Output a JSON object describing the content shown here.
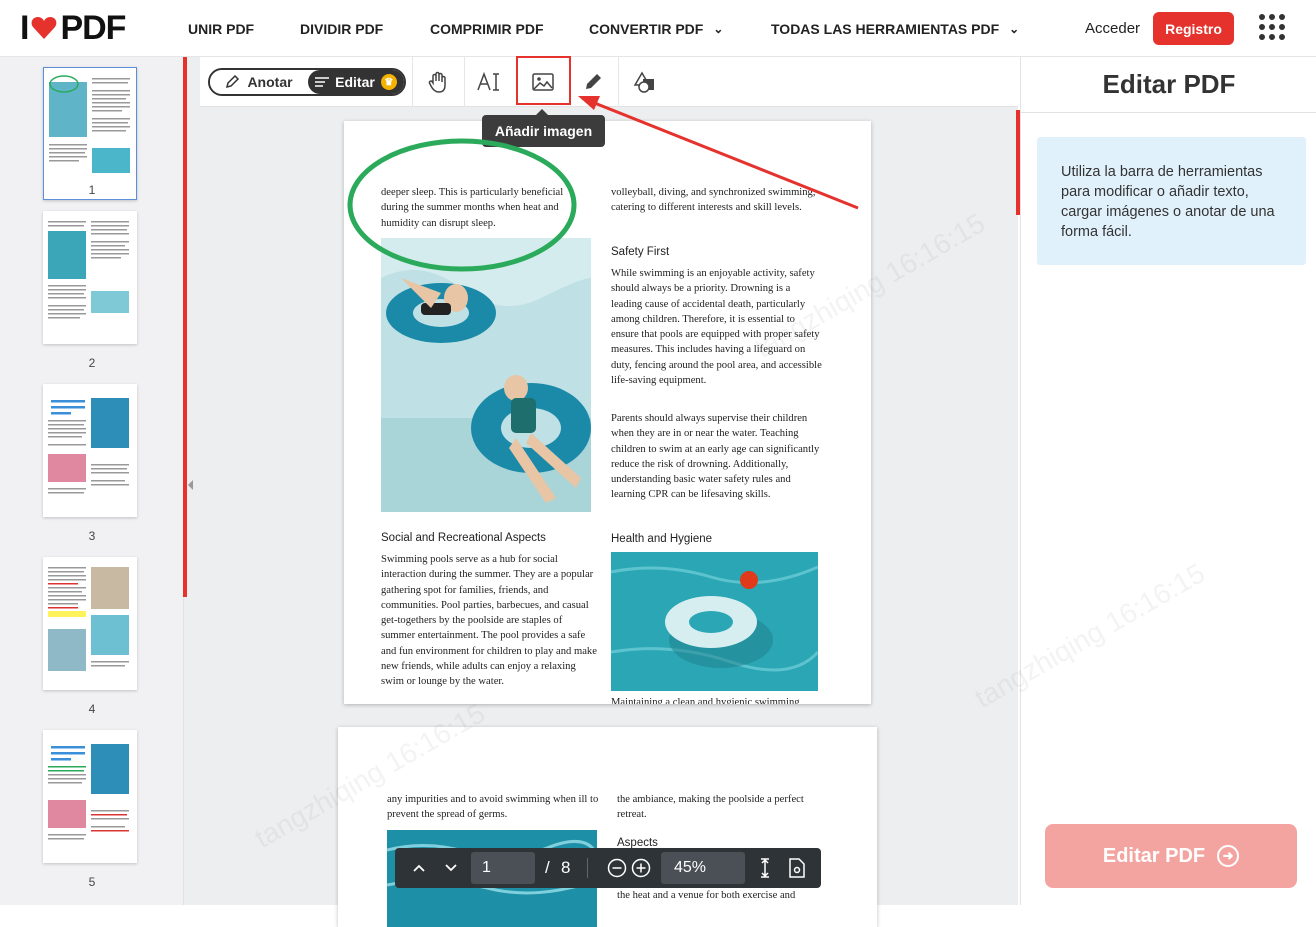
{
  "header": {
    "logo_text_left": "I",
    "logo_text_right": "PDF",
    "nav": [
      {
        "label": "UNIR PDF"
      },
      {
        "label": "DIVIDIR PDF"
      },
      {
        "label": "COMPRIMIR PDF"
      },
      {
        "label": "CONVERTIR PDF"
      },
      {
        "label": "TODAS LAS HERRAMIENTAS PDF"
      }
    ],
    "login": "Acceder",
    "register": "Registro"
  },
  "toolbar": {
    "annotate_label": "Anotar",
    "edit_label": "Editar",
    "tooltip": "Añadir imagen"
  },
  "thumbnails": [
    {
      "number": "1"
    },
    {
      "number": "2"
    },
    {
      "number": "3"
    },
    {
      "number": "4"
    },
    {
      "number": "5"
    }
  ],
  "page1": {
    "left_top": "deeper sleep. This is particularly beneficial during the summer months when heat and humidity can disrupt sleep.",
    "left_heading": "Social and Recreational Aspects",
    "left_body": "Swimming pools serve as a hub for social interaction during the summer. They are a popular gathering spot for families, friends, and communities. Pool parties, barbecues, and casual get-togethers by the poolside are staples of summer entertainment. The pool provides a safe and fun environment for children to play and make new friends, while adults can enjoy a relaxing swim or lounge by the water.",
    "right_top": "volleyball, diving, and synchronized swimming, catering to different interests and skill levels.",
    "right_heading1": "Safety First",
    "right_para1": "While swimming is an enjoyable activity, safety should always be a priority. Drowning is a leading cause of accidental death, particularly among children. Therefore, it is essential to ensure that pools are equipped with proper safety measures. This includes having a lifeguard on duty, fencing around the pool area, and accessible life-saving equipment.",
    "right_para2": "Parents should always supervise their children when they are in or near the water. Teaching children to swim at an early age can significantly reduce the risk of drowning. Additionally, understanding basic water safety rules and learning CPR can be lifesaving skills.",
    "right_heading2": "Health and Hygiene",
    "right_bottom": "Maintaining a clean and hygienic swimming"
  },
  "page2": {
    "left_top": "any impurities and to avoid swimming when ill to prevent the spread of germs.",
    "right_top": "the ambiance, making the poolside a perfect retreat.",
    "right_heading": "Aspects",
    "right_bottom": "the heat and a venue for both exercise and"
  },
  "right_panel": {
    "title": "Editar PDF",
    "info": "Utiliza la barra de herramientas para modificar o añadir texto, cargar imágenes o anotar de una forma fácil.",
    "action_button": "Editar PDF"
  },
  "pager": {
    "current_page": "1",
    "separator": "/",
    "total_pages": "8",
    "zoom": "45%"
  },
  "watermark_text": "tangzhiqing 16:16:15",
  "colors": {
    "brand_red": "#e5322d",
    "annotation_green": "#2aaa5a",
    "info_bg": "#e1f1fb"
  }
}
